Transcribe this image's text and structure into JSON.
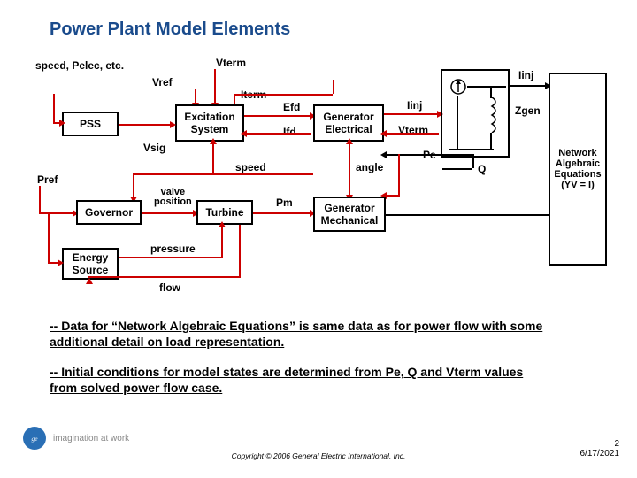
{
  "title": "Power Plant Model Elements",
  "blocks": {
    "pss": "PSS",
    "excitation": "Excitation\nSystem",
    "gen_elec": "Generator\nElectrical",
    "governor": "Governor",
    "energy": "Energy\nSource",
    "turbine": "Turbine",
    "gen_mech": "Generator\nMechanical",
    "network": "Network\nAlgebraic\nEquations\n(YV = I)"
  },
  "signals": {
    "inputs": "speed,\nPelec,\netc.",
    "vref": "Vref",
    "vterm": "Vterm",
    "iterm": "Iterm",
    "efd": "Efd",
    "ifd": "Ifd",
    "iinj": "Iinj",
    "iinj2": "Iinj",
    "vterm2": "Vterm",
    "zgen": "Zgen",
    "pe": "Pe",
    "q": "Q",
    "vsig": "Vsig",
    "speed": "speed",
    "angle": "angle",
    "pref": "Pref",
    "valve": "valve\nposition",
    "pm": "Pm",
    "pressure": "pressure",
    "flow": "flow"
  },
  "notes": {
    "n1": "-- Data for “Network Algebraic Equations” is same data as for power flow with some additional detail on load representation.",
    "n2": "-- Initial conditions for model states are determined from Pe, Q and Vterm values from solved power flow case."
  },
  "footer": {
    "tagline": "imagination at work",
    "copyright": "Copyright © 2006 General Electric International, Inc.",
    "page": "2",
    "date": "6/17/2021"
  },
  "icons": {
    "ge": "ge-monogram",
    "current_source": "current-source",
    "inductor": "inductor"
  }
}
